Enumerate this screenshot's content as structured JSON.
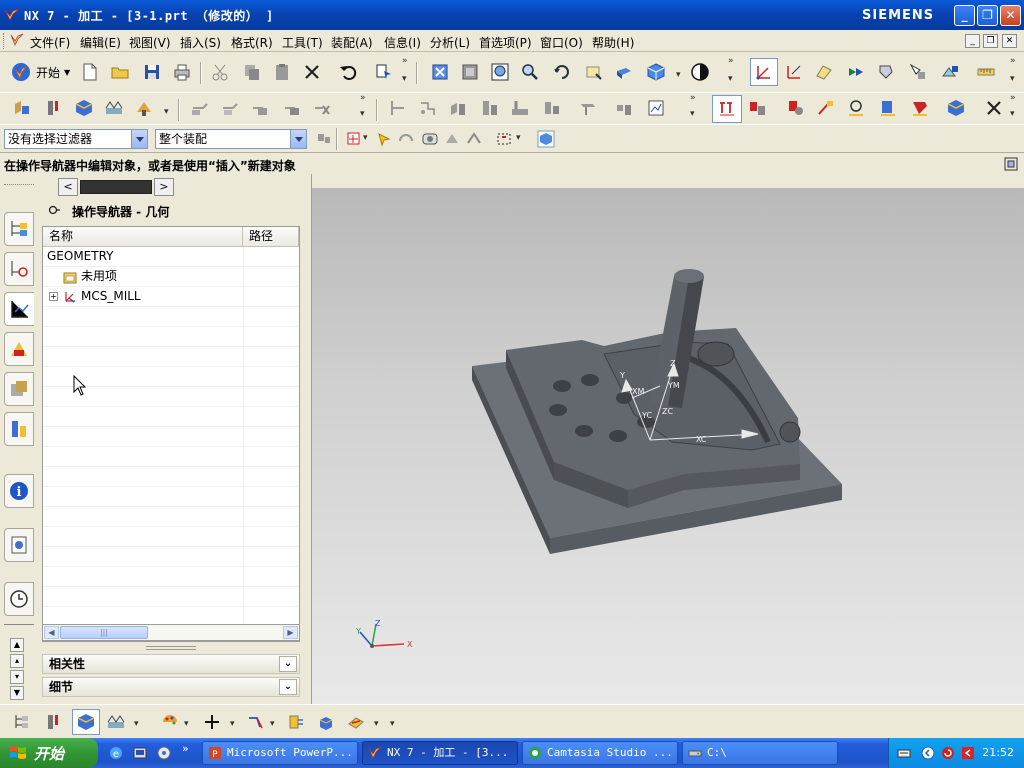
{
  "window": {
    "title": "NX 7 - 加工 - [3-1.prt （修改的） ]",
    "brand": "SIEMENS"
  },
  "menu": {
    "items": [
      "文件(F)",
      "编辑(E)",
      "视图(V)",
      "插入(S)",
      "格式(R)",
      "工具(T)",
      "装配(A)",
      "信息(I)",
      "分析(L)",
      "首选项(P)",
      "窗口(O)",
      "帮助(H)"
    ]
  },
  "toolbar": {
    "start_label": "开始"
  },
  "selection": {
    "filter_value": "没有选择过滤器",
    "scope_value": "整个装配"
  },
  "status": {
    "message": "在操作导航器中编辑对象，或者是使用“插入”新建对象"
  },
  "navigator": {
    "title": "操作导航器 - 几何",
    "columns": [
      "名称",
      "路径"
    ],
    "rows": [
      {
        "name": "GEOMETRY",
        "path": ""
      },
      {
        "name": "未用项",
        "path": ""
      },
      {
        "name": "MCS_MILL",
        "path": ""
      }
    ],
    "sections": [
      "相关性",
      "细节"
    ]
  },
  "viewport": {
    "csys_labels": [
      "Z",
      "YM",
      "XM",
      "YC",
      "ZC",
      "XC",
      "Y"
    ],
    "triad_labels": [
      "Z",
      "Y",
      "X"
    ]
  },
  "taskbar": {
    "start_label": "开始",
    "tasks": [
      "Microsoft PowerP...",
      "NX 7 - 加工 - [3...",
      "Camtasia Studio ...",
      "C:\\"
    ],
    "clock": "21:52"
  },
  "colors": {
    "title_bar": "#0842b0",
    "taskbar": "#245edb",
    "start_button": "#339535",
    "part_gray": "#5d6268"
  }
}
